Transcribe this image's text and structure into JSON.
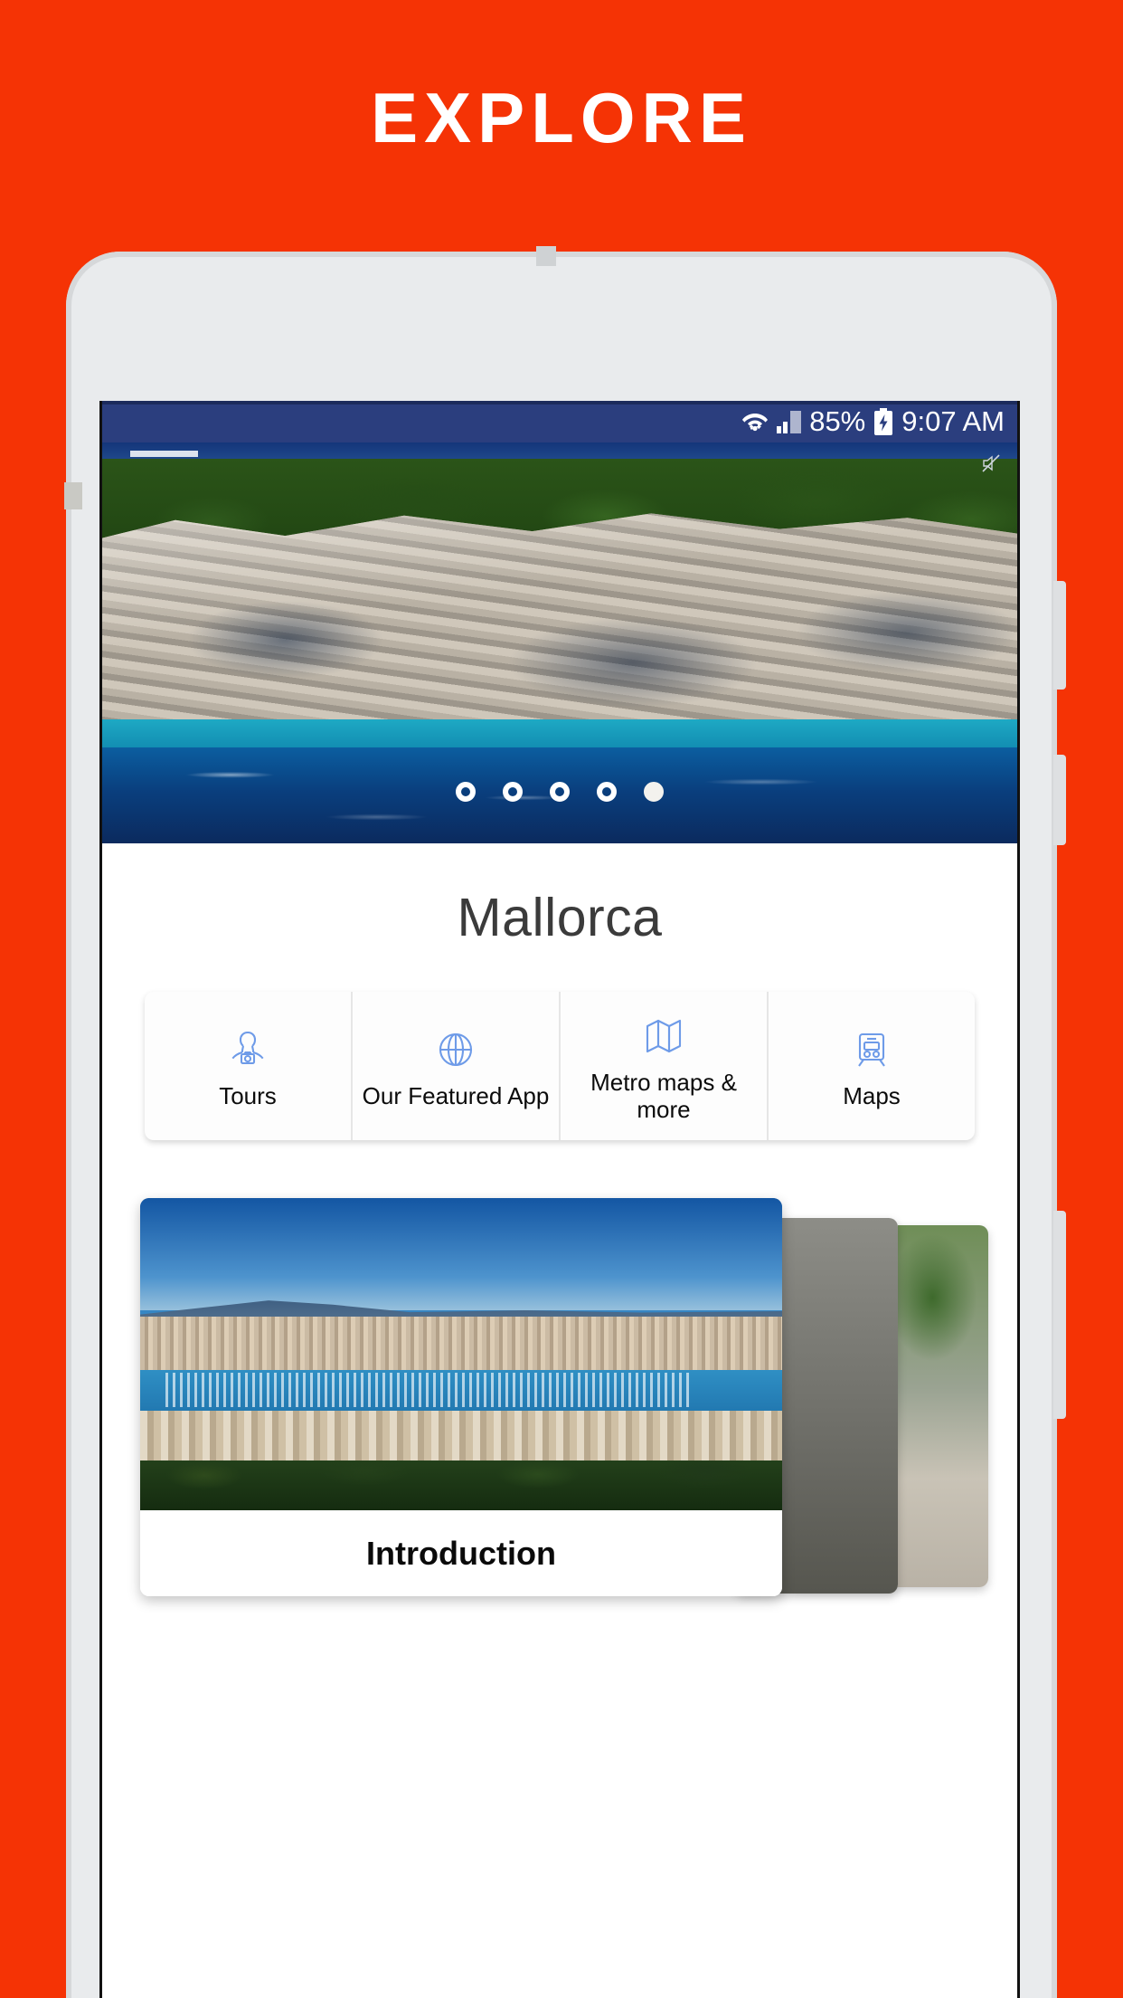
{
  "header": {
    "title": "EXPLORE"
  },
  "accent_color": "#F53305",
  "status_bar": {
    "battery_percent": "85%",
    "time": "9:07 AM",
    "icons": [
      "wifi-icon",
      "cell-signal-icon",
      "battery-charging-icon"
    ],
    "background_color": "#2B3E7E"
  },
  "hero": {
    "alt": "Coastal cliff with turquoise sea",
    "dots": [
      {
        "active": false
      },
      {
        "active": false
      },
      {
        "active": false
      },
      {
        "active": false
      },
      {
        "active": true
      }
    ]
  },
  "place": {
    "title": "Mallorca"
  },
  "tiles": [
    {
      "label": "Tours",
      "icon": "tourist-with-camera-icon",
      "color": "#6E9BE8"
    },
    {
      "label": "Our Featured App",
      "icon": "globe-icon",
      "color": "#6E9BE8"
    },
    {
      "label": "Metro maps & more",
      "icon": "folded-map-icon",
      "color": "#6E9BE8"
    },
    {
      "label": "Maps",
      "icon": "train-icon",
      "color": "#6E9BE8"
    }
  ],
  "cards": [
    {
      "title": "Introduction",
      "alt": "Aerial view of Palma de Mallorca harbour"
    },
    {
      "title": "",
      "alt": "Street scene card behind"
    },
    {
      "title": "",
      "alt": "Tree-lined card behind"
    }
  ]
}
